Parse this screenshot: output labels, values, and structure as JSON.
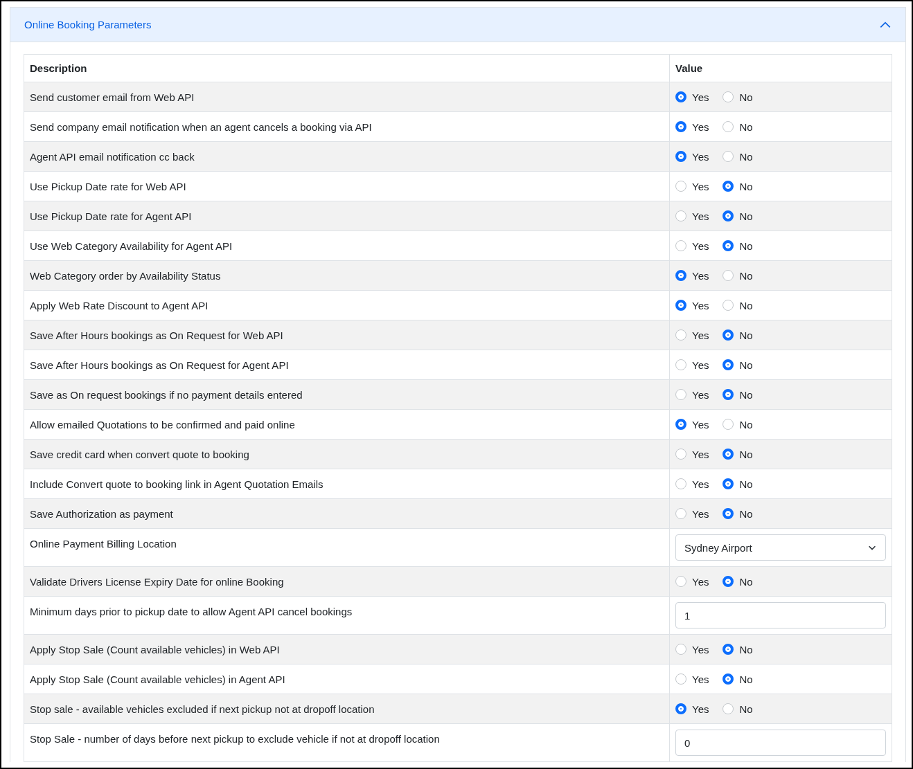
{
  "panel": {
    "title": "Online Booking Parameters",
    "expanded": true
  },
  "table": {
    "columns": [
      "Description",
      "Value"
    ],
    "rows": [
      {
        "kind": "radio",
        "description": "Send customer email from Web API",
        "options": [
          {
            "label": "Yes",
            "selected": true
          },
          {
            "label": "No",
            "selected": false
          }
        ]
      },
      {
        "kind": "radio",
        "description": "Send company email notification when an agent cancels a booking via API",
        "options": [
          {
            "label": "Yes",
            "selected": true
          },
          {
            "label": "No",
            "selected": false
          }
        ]
      },
      {
        "kind": "radio",
        "description": "Agent API email notification cc back",
        "options": [
          {
            "label": "Yes",
            "selected": true
          },
          {
            "label": "No",
            "selected": false
          }
        ]
      },
      {
        "kind": "radio",
        "description": "Use Pickup Date rate for Web API",
        "options": [
          {
            "label": "Yes",
            "selected": false
          },
          {
            "label": "No",
            "selected": true
          }
        ]
      },
      {
        "kind": "radio",
        "description": "Use Pickup Date rate for Agent API",
        "options": [
          {
            "label": "Yes",
            "selected": false
          },
          {
            "label": "No",
            "selected": true
          }
        ]
      },
      {
        "kind": "radio",
        "description": "Use Web Category Availability for Agent API",
        "options": [
          {
            "label": "Yes",
            "selected": false
          },
          {
            "label": "No",
            "selected": true
          }
        ]
      },
      {
        "kind": "radio",
        "description": "Web Category order by Availability Status",
        "options": [
          {
            "label": "Yes",
            "selected": true
          },
          {
            "label": "No",
            "selected": false
          }
        ]
      },
      {
        "kind": "radio",
        "description": "Apply Web Rate Discount to Agent API",
        "options": [
          {
            "label": "Yes",
            "selected": true
          },
          {
            "label": "No",
            "selected": false
          }
        ]
      },
      {
        "kind": "radio",
        "description": "Save After Hours bookings as On Request for Web API",
        "options": [
          {
            "label": "Yes",
            "selected": false
          },
          {
            "label": "No",
            "selected": true
          }
        ]
      },
      {
        "kind": "radio",
        "description": "Save After Hours bookings as On Request for Agent API",
        "options": [
          {
            "label": "Yes",
            "selected": false
          },
          {
            "label": "No",
            "selected": true
          }
        ]
      },
      {
        "kind": "radio",
        "description": "Save as On request bookings if no payment details entered",
        "options": [
          {
            "label": "Yes",
            "selected": false
          },
          {
            "label": "No",
            "selected": true
          }
        ]
      },
      {
        "kind": "radio",
        "description": "Allow emailed Quotations to be confirmed and paid online",
        "options": [
          {
            "label": "Yes",
            "selected": true
          },
          {
            "label": "No",
            "selected": false
          }
        ]
      },
      {
        "kind": "radio",
        "description": "Save credit card when convert quote to booking",
        "options": [
          {
            "label": "Yes",
            "selected": false
          },
          {
            "label": "No",
            "selected": true
          }
        ]
      },
      {
        "kind": "radio",
        "description": "Include Convert quote to booking link in Agent Quotation Emails",
        "options": [
          {
            "label": "Yes",
            "selected": false
          },
          {
            "label": "No",
            "selected": true
          }
        ]
      },
      {
        "kind": "radio",
        "description": "Save Authorization as payment",
        "options": [
          {
            "label": "Yes",
            "selected": false
          },
          {
            "label": "No",
            "selected": true
          }
        ]
      },
      {
        "kind": "select",
        "description": "Online Payment Billing Location",
        "value": "Sydney Airport"
      },
      {
        "kind": "radio",
        "description": "Validate Drivers License Expiry Date for online Booking",
        "options": [
          {
            "label": "Yes",
            "selected": false
          },
          {
            "label": "No",
            "selected": true
          }
        ]
      },
      {
        "kind": "input",
        "description": "Minimum days prior to pickup date to allow Agent API cancel bookings",
        "value": "1"
      },
      {
        "kind": "radio",
        "description": "Apply Stop Sale (Count available vehicles) in Web API",
        "options": [
          {
            "label": "Yes",
            "selected": false
          },
          {
            "label": "No",
            "selected": true
          }
        ]
      },
      {
        "kind": "radio",
        "description": "Apply Stop Sale (Count available vehicles) in Agent API",
        "options": [
          {
            "label": "Yes",
            "selected": false
          },
          {
            "label": "No",
            "selected": true
          }
        ]
      },
      {
        "kind": "radio",
        "description": "Stop sale - available vehicles excluded if next pickup not at dropoff location",
        "options": [
          {
            "label": "Yes",
            "selected": true
          },
          {
            "label": "No",
            "selected": false
          }
        ]
      },
      {
        "kind": "input",
        "description": "Stop Sale - number of days before next pickup to exclude vehicle if not at dropoff location",
        "value": "0"
      }
    ]
  }
}
